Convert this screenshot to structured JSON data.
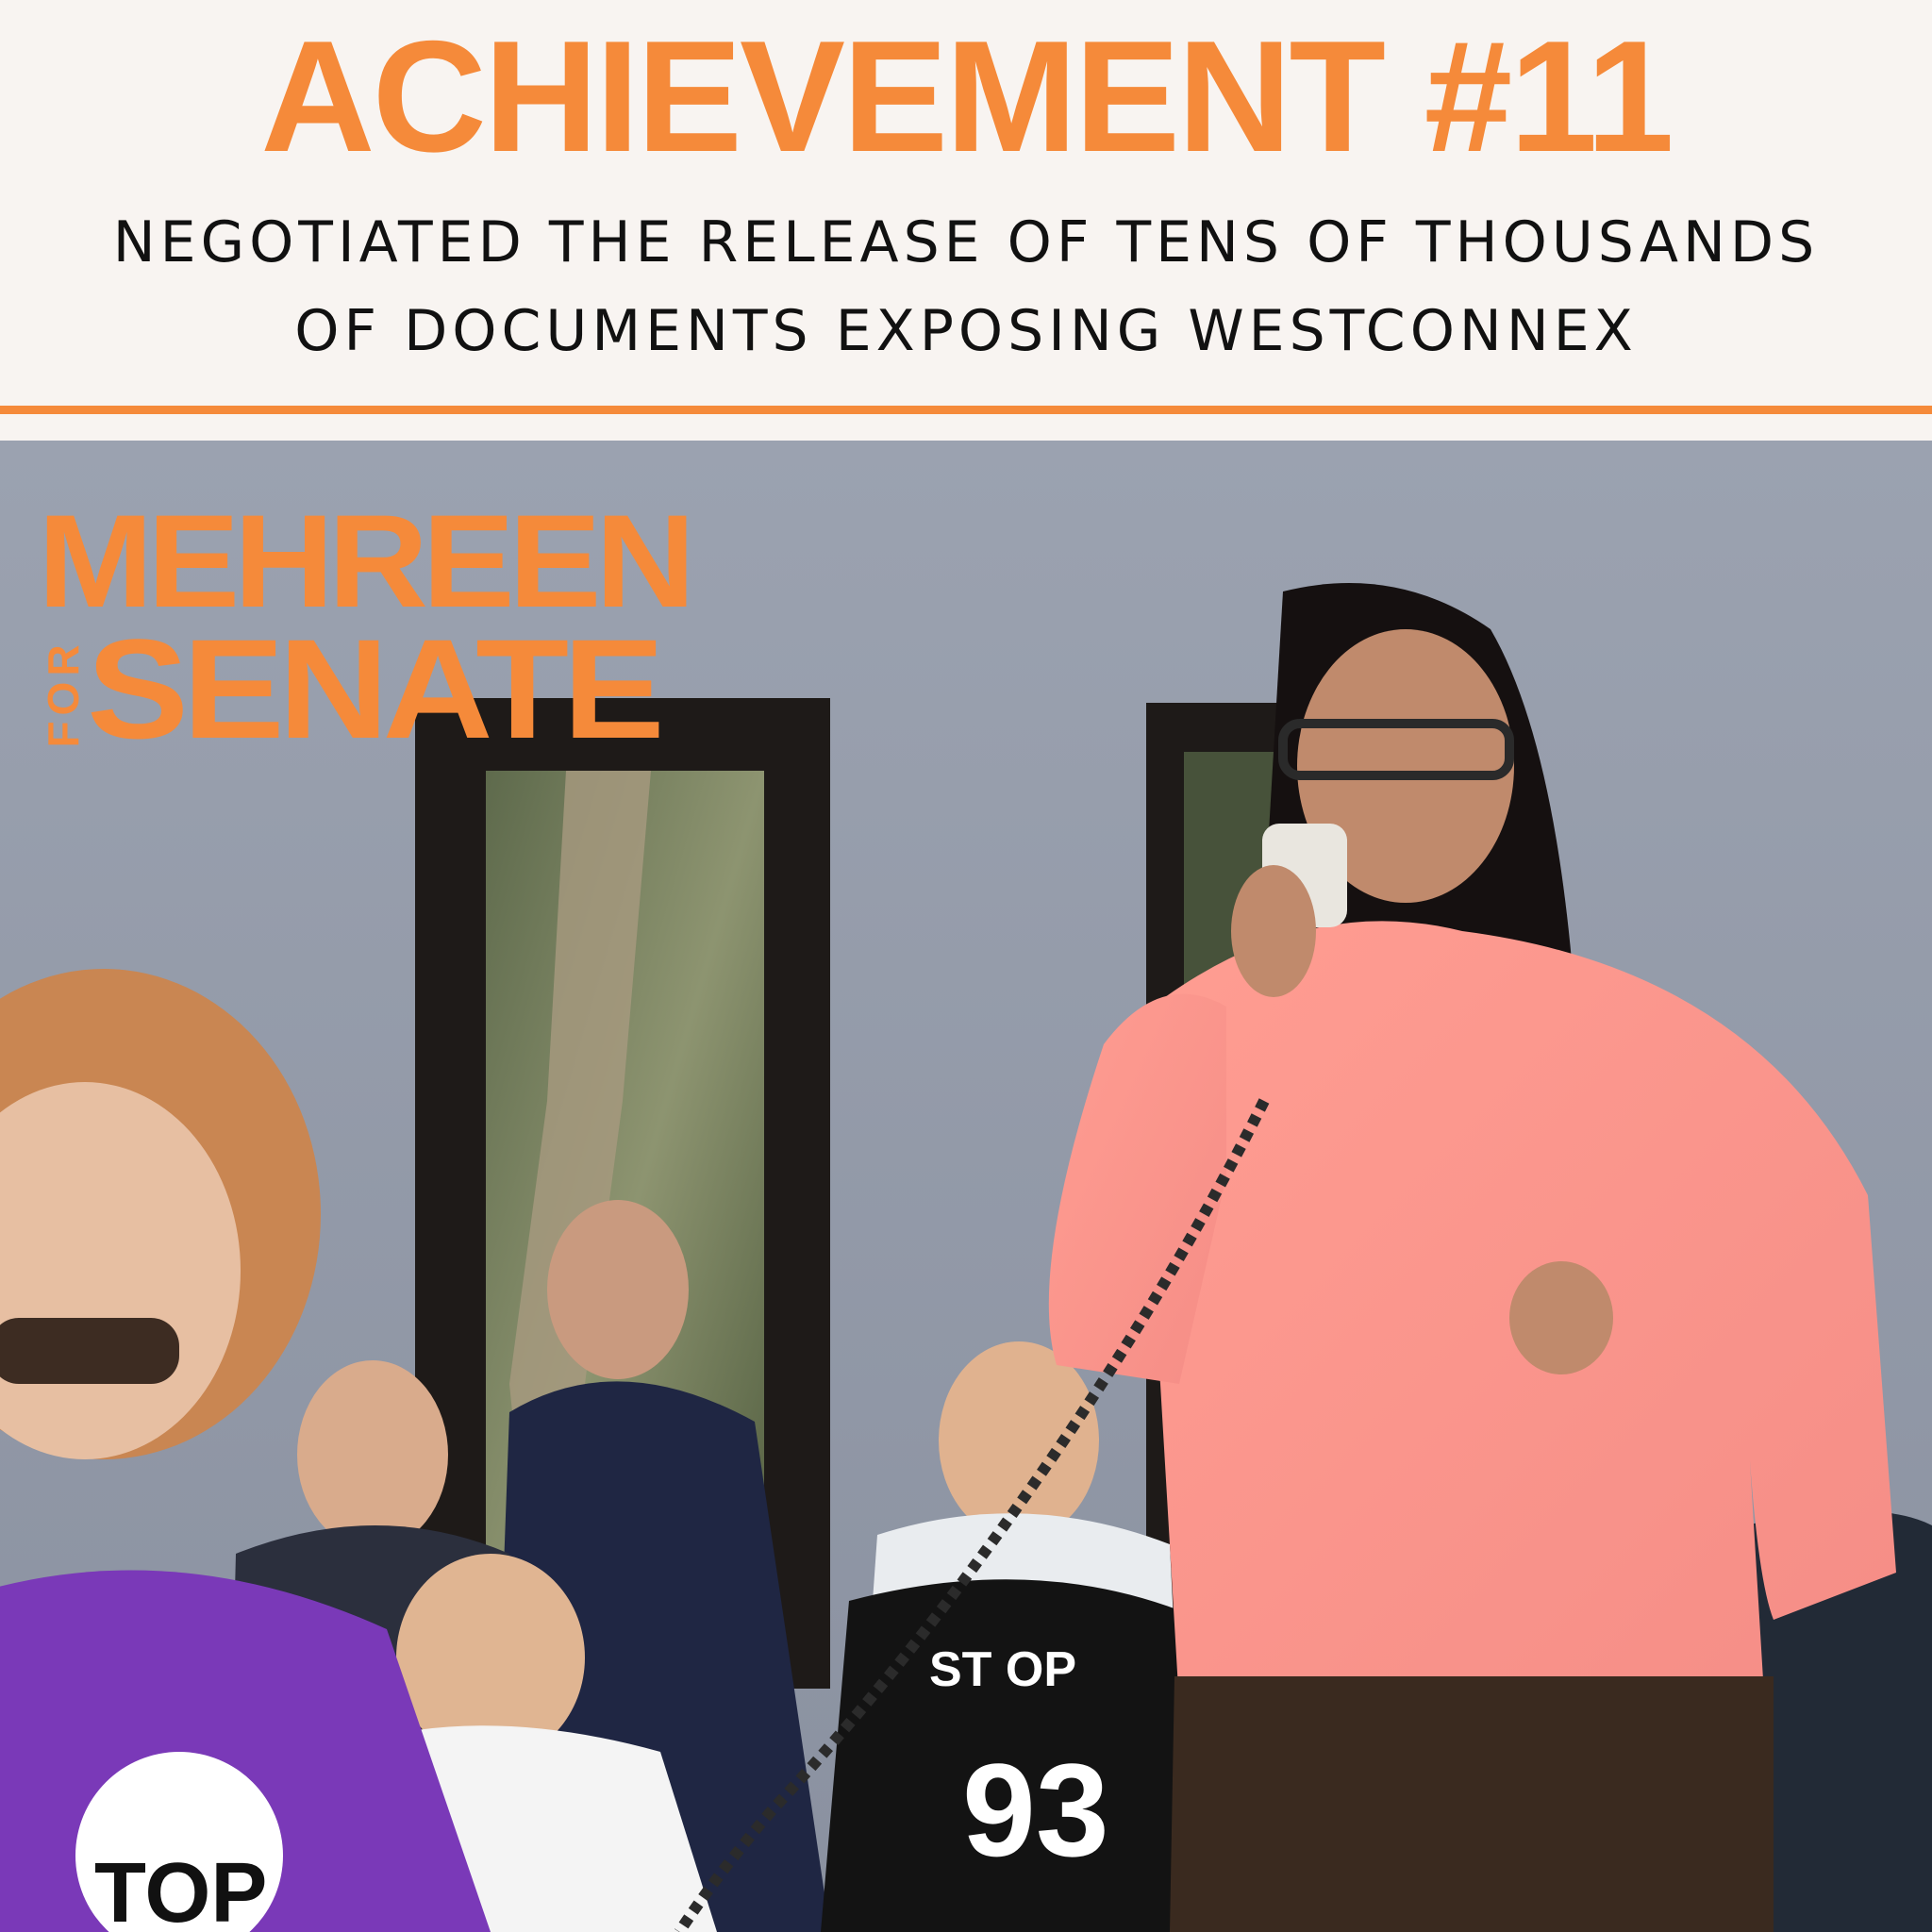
{
  "header": {
    "title": "ACHIEVEMENT #11",
    "subtitle_line1": "NEGOTIATED THE RELEASE OF TENS OF THOUSANDS",
    "subtitle_line2": "OF DOCUMENTS EXPOSING WESTCONNEX"
  },
  "logo": {
    "line1": "MEHREEN",
    "for": "FOR",
    "line2": "SENATE"
  },
  "photo": {
    "shirt_text_1": "ST  OP",
    "shirt_number": "93",
    "sign_text": "TOP"
  },
  "colors": {
    "accent": "#f58a3a",
    "background": "#f8f4f1",
    "wall": "#8f97a6"
  }
}
